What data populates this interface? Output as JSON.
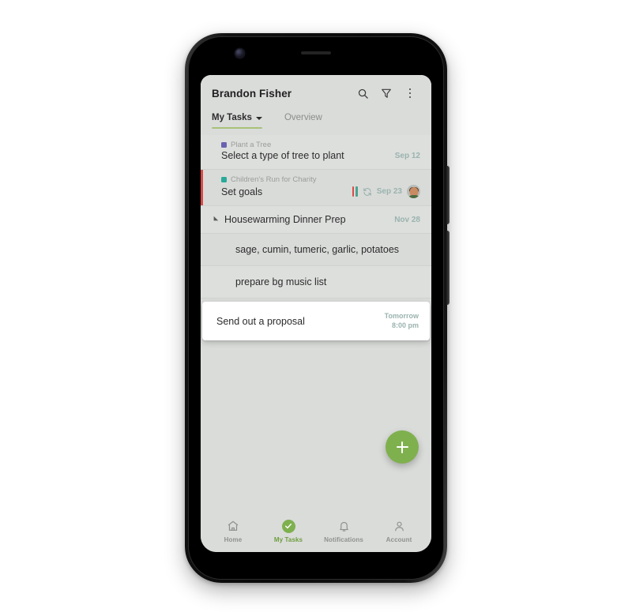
{
  "app": {
    "header": {
      "title": "Brandon Fisher",
      "search_icon": "search-icon",
      "filter_icon": "filter-funnel-icon",
      "overflow_icon": "more-vertical-icon"
    },
    "tabs": [
      {
        "label": "My Tasks",
        "active": true,
        "has_dropdown": true
      },
      {
        "label": "Overview",
        "active": false,
        "has_dropdown": false
      }
    ],
    "accent_color": "#7fb04e",
    "tab_underline_color": "#a8c179",
    "due_text_color": "#9ab3ae",
    "priority_stripe_color": "#d94a4a"
  },
  "tasks": [
    {
      "project": "Plant a Tree",
      "project_color": "#6a62b0",
      "title": "Select a type of tree to plant",
      "due": "Sep 12",
      "stripe": false,
      "has_priority_bars": false,
      "has_recurring": false,
      "has_avatar": false
    },
    {
      "project": "Children's Run for Charity",
      "project_color": "#29a99a",
      "title": "Set goals",
      "due": "Sep 23",
      "stripe": true,
      "has_priority_bars": true,
      "priority_bar_colors": [
        "#d94a4a",
        "#4aa38f"
      ],
      "has_recurring": true,
      "has_avatar": true
    }
  ],
  "group": {
    "title": "Housewarming Dinner Prep",
    "due": "Nov 28",
    "expanded": true,
    "subtasks": [
      {
        "title": "sage, cumin, tumeric, garlic, potatoes"
      },
      {
        "title": "prepare bg music list"
      }
    ]
  },
  "highlighted_task": {
    "title": "Send out a proposal",
    "due_day": "Tomorrow",
    "due_time": "8:00 pm"
  },
  "fab": {
    "label": "+",
    "name": "add-task-button"
  },
  "bottom_nav": [
    {
      "label": "Home",
      "icon": "home-icon",
      "active": false
    },
    {
      "label": "My Tasks",
      "icon": "check-circle-icon",
      "active": true
    },
    {
      "label": "Notifications",
      "icon": "bell-icon",
      "active": false
    },
    {
      "label": "Account",
      "icon": "person-icon",
      "active": false
    }
  ]
}
